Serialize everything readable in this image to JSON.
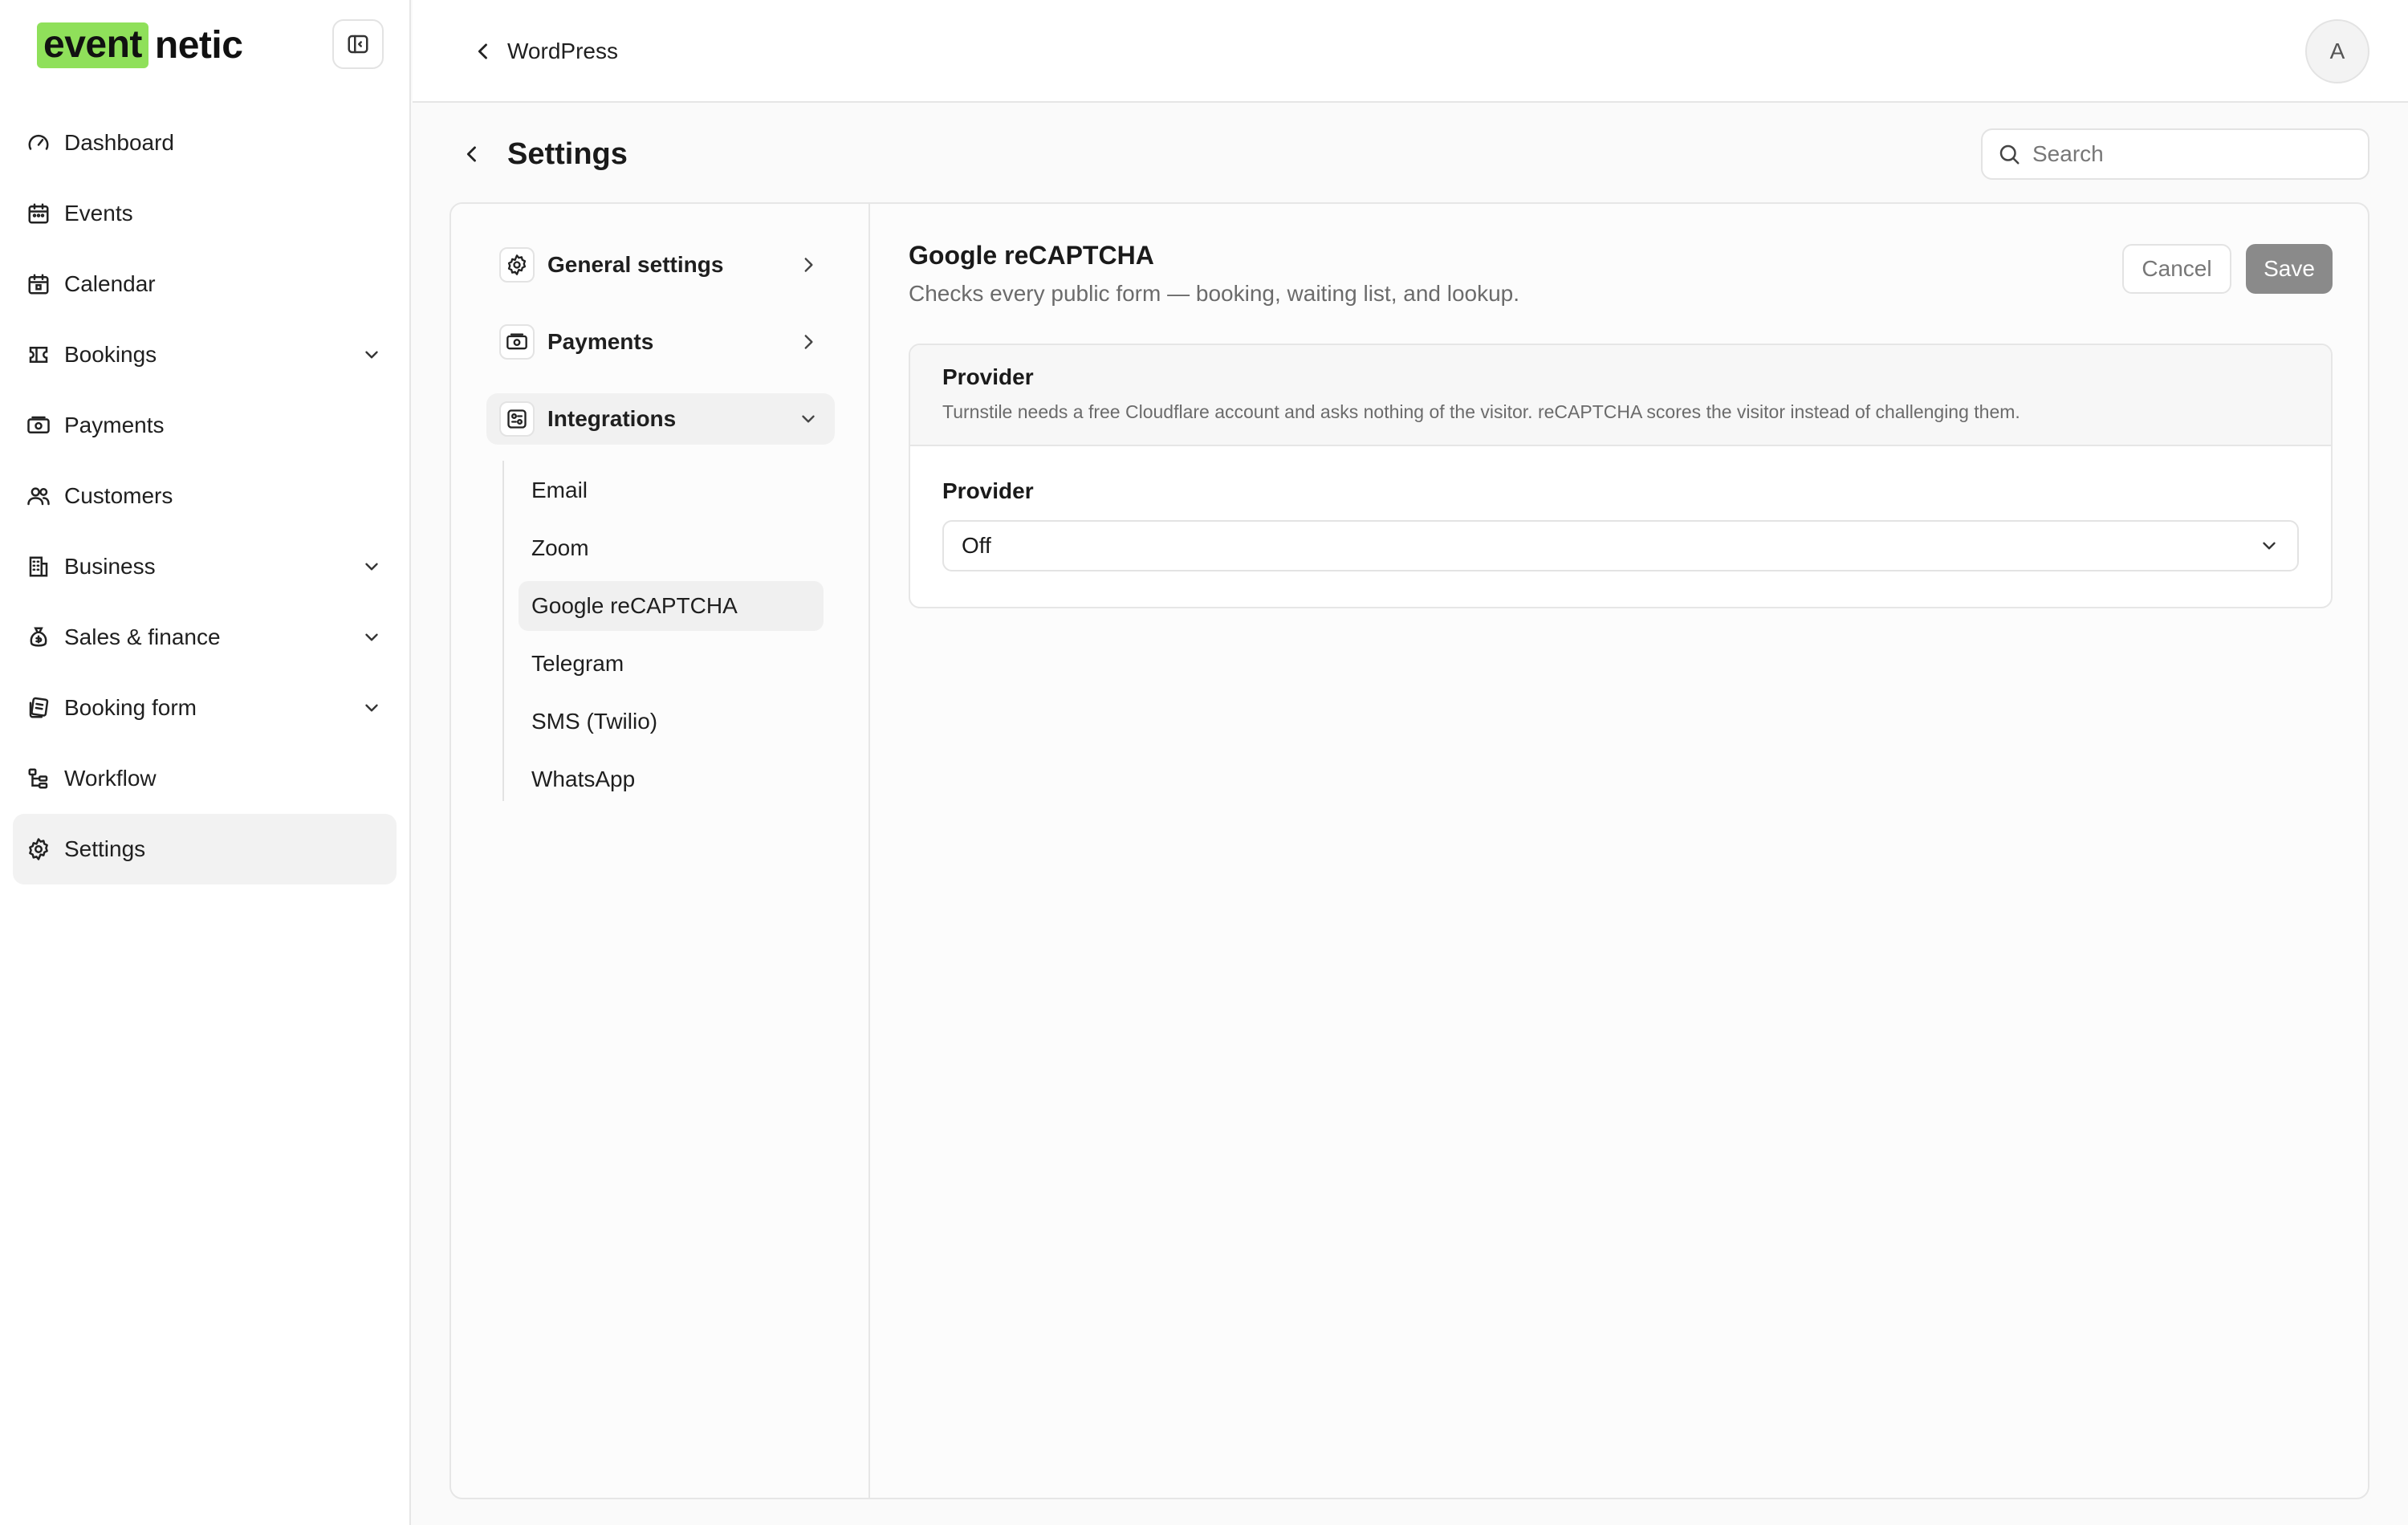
{
  "brand": {
    "logo_highlight": "event",
    "logo_rest": "netic",
    "accent_color": "#8fe05a"
  },
  "sidebar": {
    "items": [
      {
        "label": "Dashboard",
        "icon": "gauge-icon",
        "expandable": false,
        "active": false
      },
      {
        "label": "Events",
        "icon": "calendar-icon",
        "expandable": false,
        "active": false
      },
      {
        "label": "Calendar",
        "icon": "calendar-grid-icon",
        "expandable": false,
        "active": false
      },
      {
        "label": "Bookings",
        "icon": "ticket-icon",
        "expandable": true,
        "active": false
      },
      {
        "label": "Payments",
        "icon": "banknote-icon",
        "expandable": false,
        "active": false
      },
      {
        "label": "Customers",
        "icon": "users-icon",
        "expandable": false,
        "active": false
      },
      {
        "label": "Business",
        "icon": "building-icon",
        "expandable": true,
        "active": false
      },
      {
        "label": "Sales & finance",
        "icon": "money-bag-icon",
        "expandable": true,
        "active": false
      },
      {
        "label": "Booking form",
        "icon": "form-icon",
        "expandable": true,
        "active": false
      },
      {
        "label": "Workflow",
        "icon": "workflow-icon",
        "expandable": false,
        "active": false
      },
      {
        "label": "Settings",
        "icon": "gear-icon",
        "expandable": false,
        "active": true
      }
    ]
  },
  "topbar": {
    "back_label": "WordPress",
    "avatar_initial": "A"
  },
  "page": {
    "title": "Settings"
  },
  "search": {
    "placeholder": "Search",
    "value": ""
  },
  "settings_nav": {
    "general": "General settings",
    "payments": "Payments",
    "integrations": "Integrations",
    "integration_items": [
      "Email",
      "Zoom",
      "Google reCAPTCHA",
      "Telegram",
      "SMS (Twilio)",
      "WhatsApp"
    ],
    "active_integration": "Google reCAPTCHA"
  },
  "panel": {
    "title": "Google reCAPTCHA",
    "description": "Checks every public form — booking, waiting list, and lookup.",
    "cancel_label": "Cancel",
    "save_label": "Save",
    "section_title": "Provider",
    "section_subtitle": "Turnstile needs a free Cloudflare account and asks nothing of the visitor. reCAPTCHA scores the visitor instead of challenging them.",
    "field_label": "Provider",
    "select_value": "Off"
  }
}
